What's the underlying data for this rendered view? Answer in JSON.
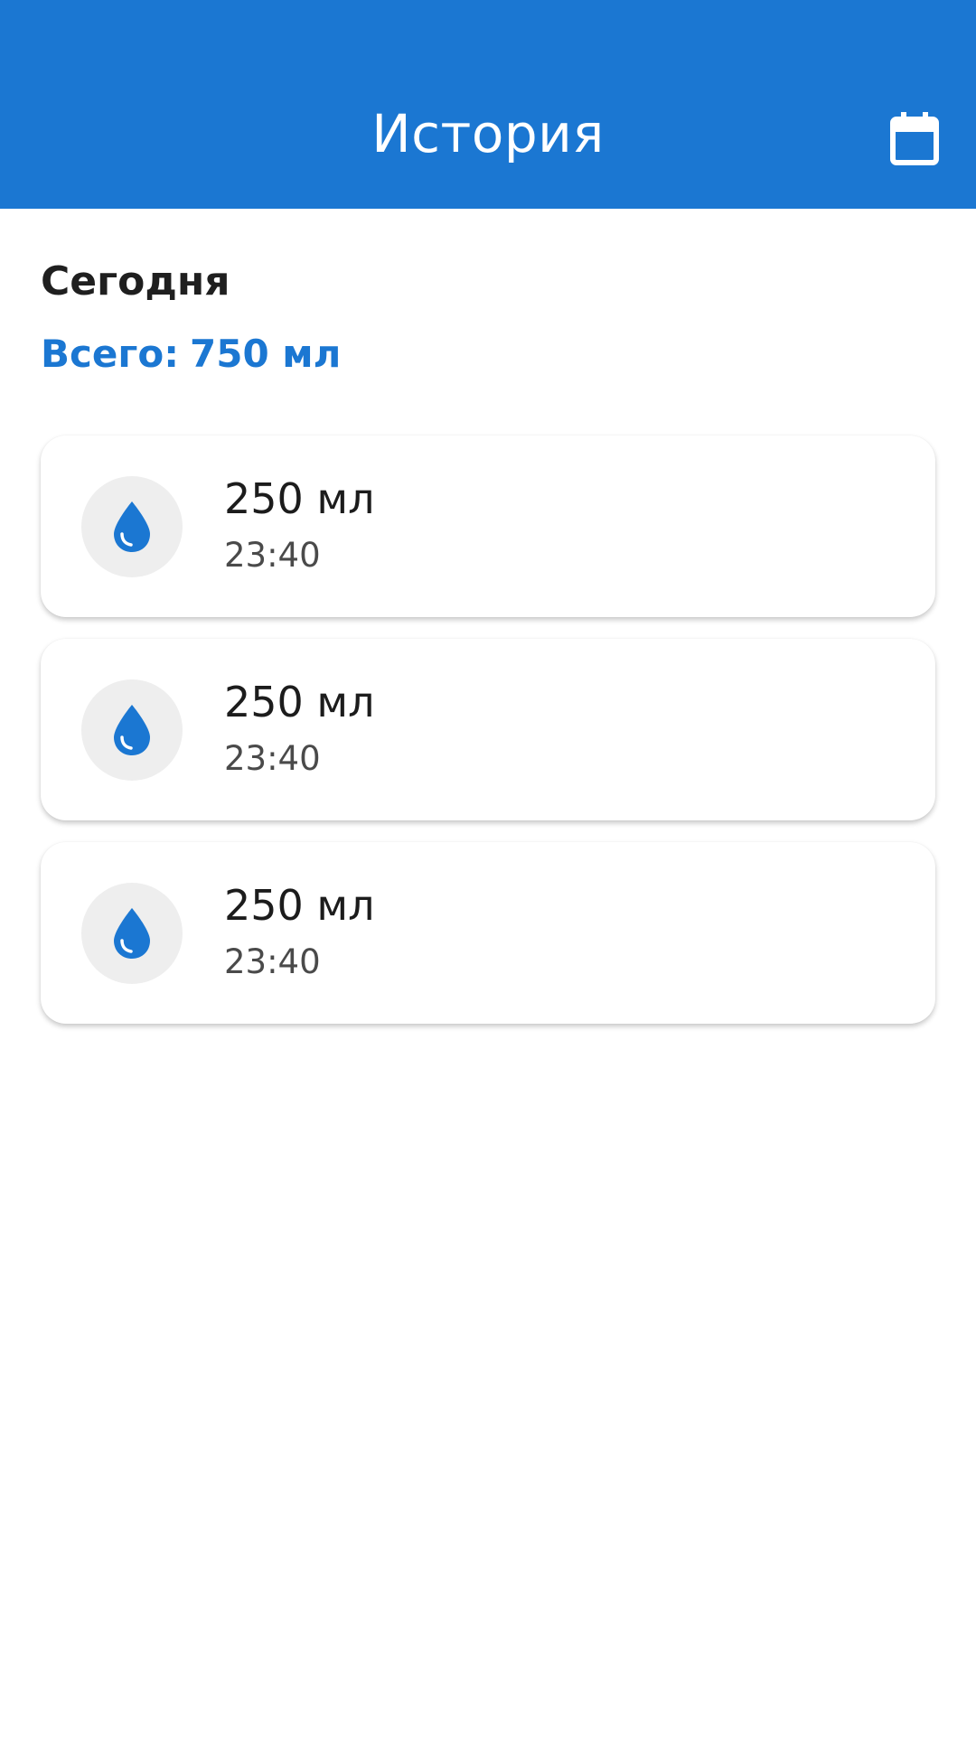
{
  "header": {
    "title": "История",
    "calendar_icon": "calendar-icon"
  },
  "section": {
    "title": "Сегодня",
    "total_label": "Всего:",
    "total_value": "750 мл"
  },
  "entries": [
    {
      "amount": "250 мл",
      "time": "23:40",
      "icon": "water-drop-icon"
    },
    {
      "amount": "250 мл",
      "time": "23:40",
      "icon": "water-drop-icon"
    },
    {
      "amount": "250 мл",
      "time": "23:40",
      "icon": "water-drop-icon"
    }
  ],
  "colors": {
    "primary": "#1b77d2",
    "icon_bg": "#eeeeee",
    "text_primary": "#1c1c1c",
    "text_secondary": "#4a4a4a"
  }
}
